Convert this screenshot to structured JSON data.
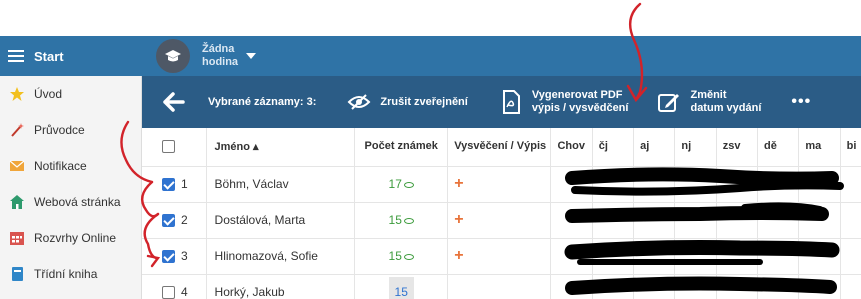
{
  "app": {
    "start_label": "Start"
  },
  "sidebar": {
    "items": [
      {
        "label": "Úvod",
        "icon": "star-icon"
      },
      {
        "label": "Průvodce",
        "icon": "magic-wand-icon"
      },
      {
        "label": "Notifikace",
        "icon": "envelope-icon"
      },
      {
        "label": "Webová stránka",
        "icon": "house-icon"
      },
      {
        "label": "Rozvrhy Online",
        "icon": "calendar-icon"
      },
      {
        "label": "Třídní kniha",
        "icon": "book-icon"
      }
    ]
  },
  "header": {
    "hour_line1": "Žádna",
    "hour_line2": "hodina"
  },
  "actions": {
    "selected_label": "Vybrané záznamy: 3:",
    "unpublish": "Zrušit zveřejnění",
    "pdf_line1": "Vygenerovat PDF",
    "pdf_line2": "výpis / vysvědčení",
    "date_line1": "Změnit",
    "date_line2": "datum vydání",
    "more": "•••"
  },
  "table": {
    "headers": {
      "name": "Jméno ▴",
      "count": "Počet známek",
      "report": "Vysvěčení / Výpis",
      "subjects": [
        "Chov",
        "čj",
        "aj",
        "nj",
        "zsv",
        "dě",
        "ma",
        "bi"
      ]
    },
    "rows": [
      {
        "num": "1",
        "name": "Böhm, Václav",
        "count": "17",
        "checked": true
      },
      {
        "num": "2",
        "name": "Dostálová, Marta",
        "count": "15",
        "checked": true
      },
      {
        "num": "3",
        "name": "Hlinomazová, Sofie",
        "count": "15",
        "checked": true
      },
      {
        "num": "4",
        "name": "Horký, Jakub",
        "count": "15",
        "checked": false
      }
    ]
  },
  "colors": {
    "header_blue": "#2f73a6",
    "action_blue": "#2b5c86",
    "count_green": "#3c9b3c",
    "plus_orange": "#e8743b",
    "annotation_red": "#d2232a"
  }
}
